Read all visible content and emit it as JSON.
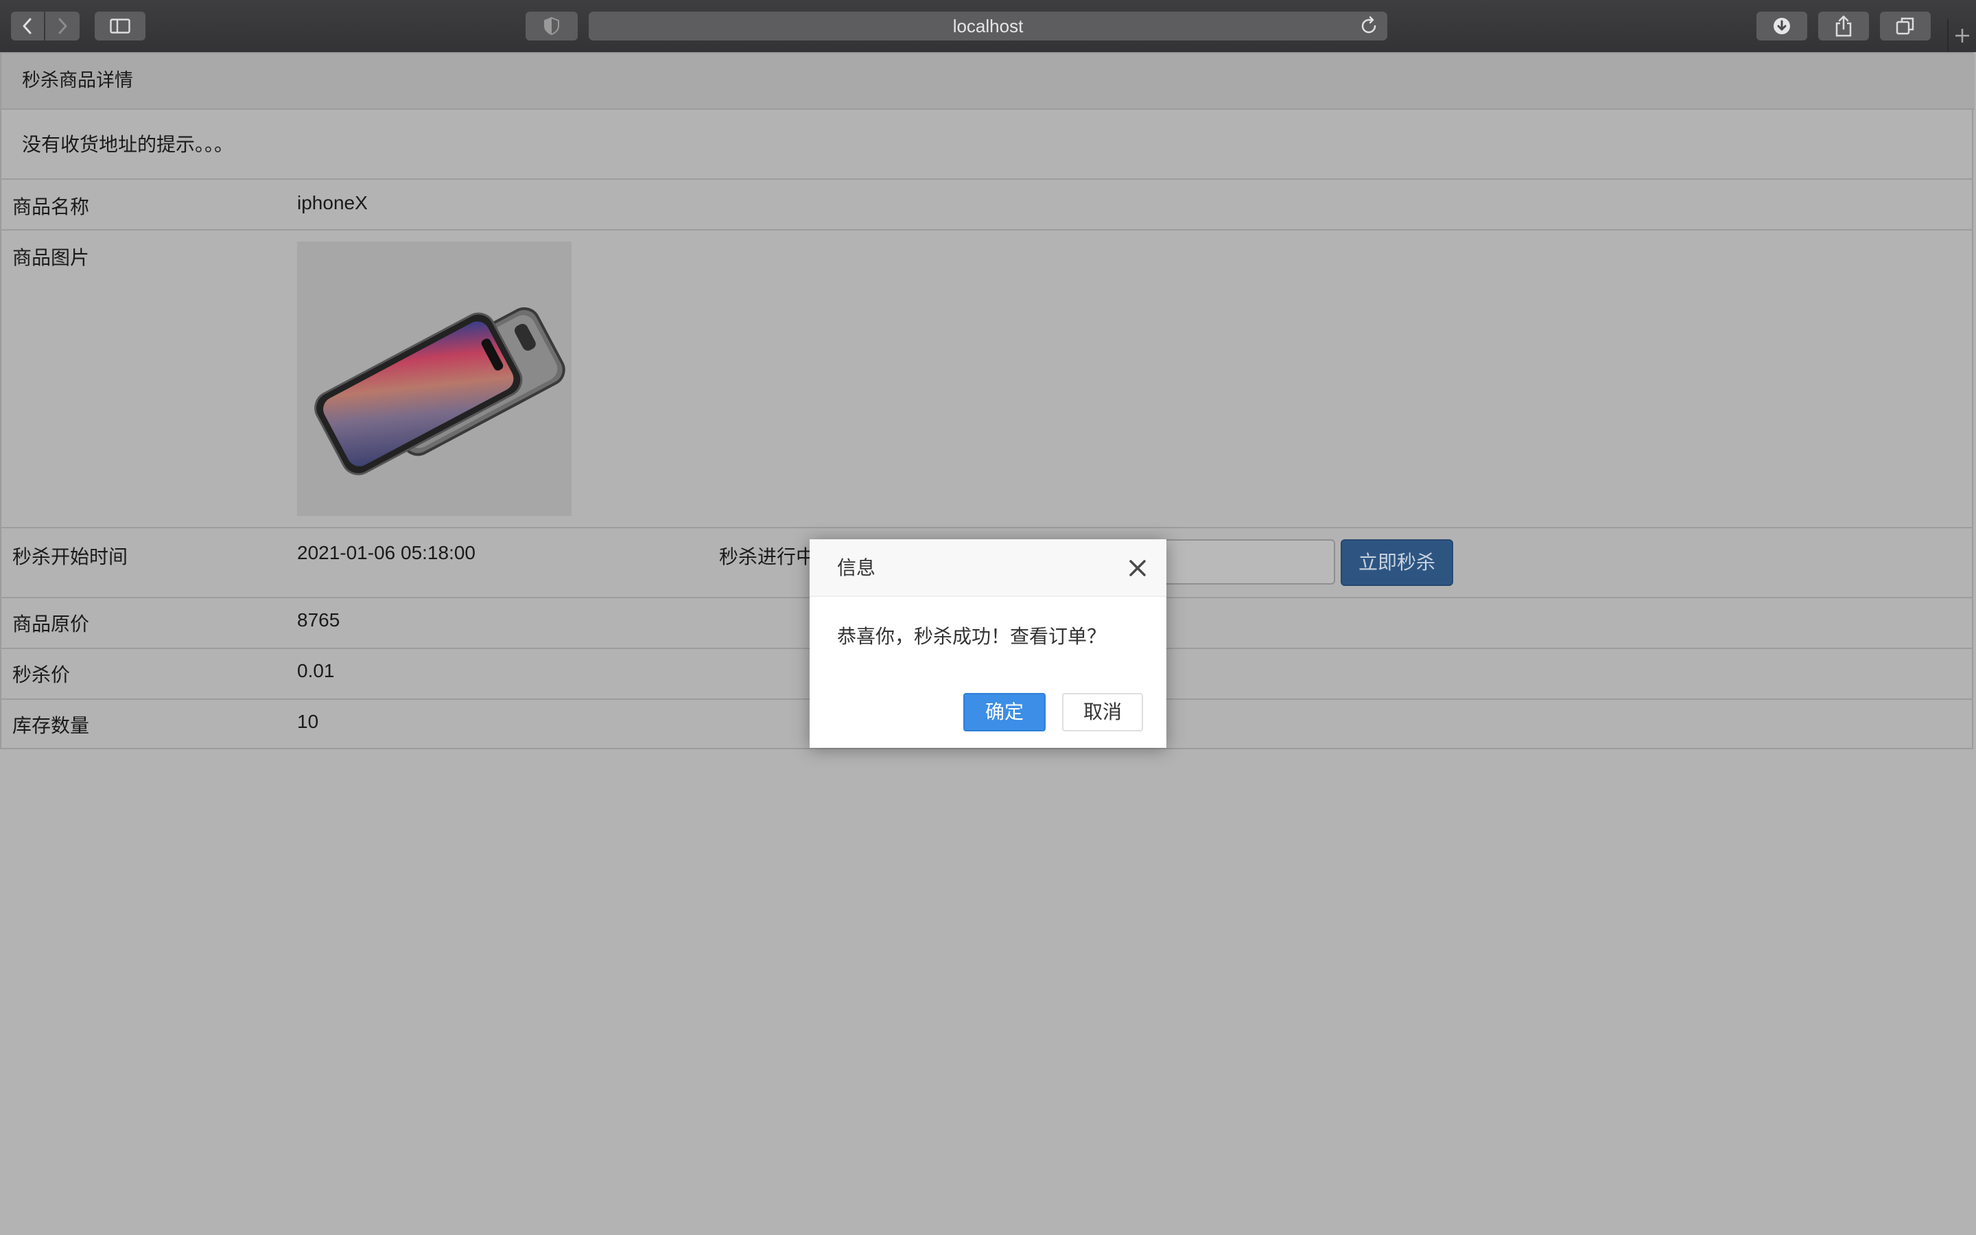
{
  "browser": {
    "url": "localhost",
    "icons": {
      "back": "chevron-left-icon",
      "forward": "chevron-right-icon",
      "sidebar": "sidebar-icon",
      "shield": "shield-icon",
      "reload": "reload-icon",
      "downloads": "download-icon",
      "share": "share-icon",
      "tabs": "tabs-overview-icon",
      "new_tab": "plus-icon"
    }
  },
  "panel": {
    "heading": "秒杀商品详情",
    "notice": "没有收货地址的提示。。。"
  },
  "details": {
    "name_label": "商品名称",
    "name_value": "iphoneX",
    "image_label": "商品图片",
    "start_time_label": "秒杀开始时间",
    "start_time_value": "2021-01-06 05:18:00",
    "status_text": "秒杀进行中",
    "seckill_button": "立即秒杀",
    "original_price_label": "商品原价",
    "original_price_value": "8765",
    "seckill_price_label": "秒杀价",
    "seckill_price_value": "0.01",
    "stock_label": "库存数量",
    "stock_value": "10"
  },
  "dialog": {
    "title": "信息",
    "message": "恭喜你，秒杀成功！查看订单？",
    "ok_label": "确定",
    "cancel_label": "取消"
  },
  "colors": {
    "overlay_bg": "#b4b4b4",
    "primary_button": "#3c8ee6",
    "seckill_button": "#2e5582"
  }
}
